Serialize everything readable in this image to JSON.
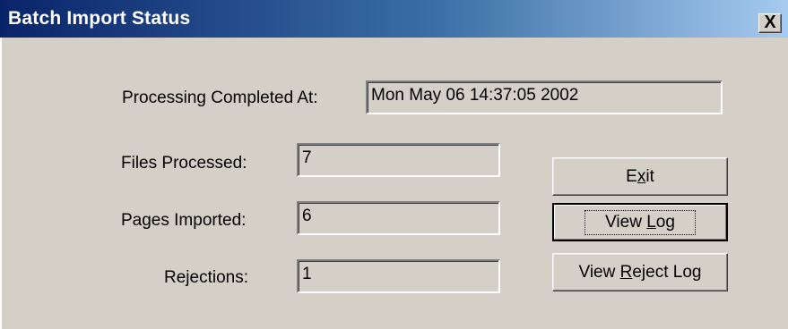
{
  "window": {
    "title": "Batch Import Status",
    "close_glyph": "X",
    "close_icon": "close-icon"
  },
  "fields": {
    "completed_label": "Processing Completed At:",
    "completed_value": "Mon May 06 14:37:05 2002",
    "files_label": "Files Processed:",
    "files_value": "7",
    "pages_label": "Pages Imported:",
    "pages_value": "6",
    "rejections_label": "Rejections:",
    "rejections_value": "1"
  },
  "buttons": {
    "exit_pre": "E",
    "exit_mnemonic": "x",
    "exit_post": "it",
    "view_log_pre": "View ",
    "view_log_mnemonic": "L",
    "view_log_post": "og",
    "reject_pre": "View ",
    "reject_mnemonic": "R",
    "reject_post": "eject Log"
  }
}
